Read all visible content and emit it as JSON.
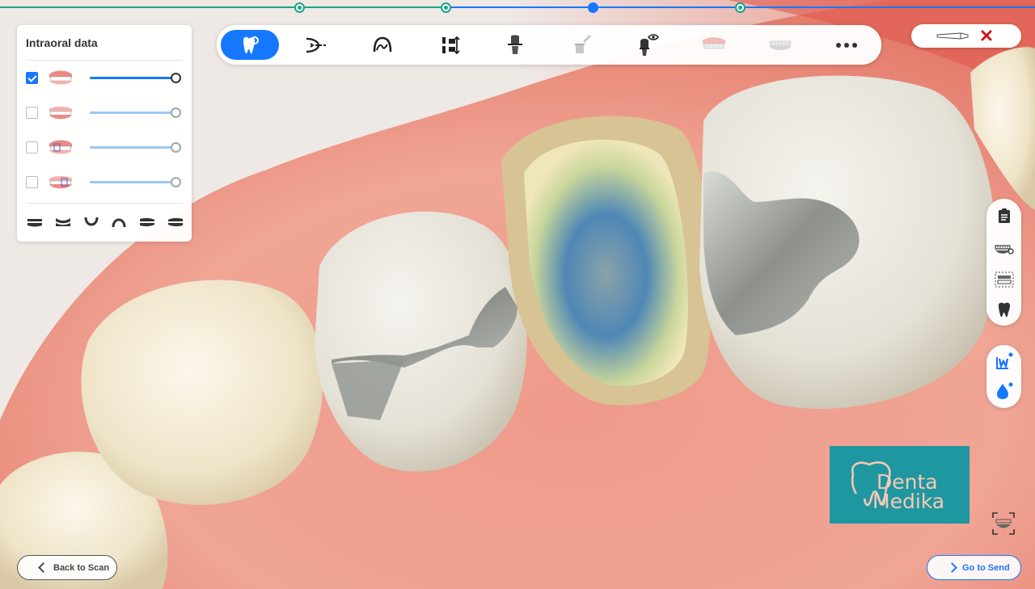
{
  "panel": {
    "title": "Intraoral data",
    "layers": [
      {
        "name": "Upper jaw scan",
        "checked": true,
        "opacity": 1.0
      },
      {
        "name": "Lower jaw scan",
        "checked": false,
        "opacity": 1.0
      },
      {
        "name": "Upper pre-op scan",
        "checked": false,
        "opacity": 1.0
      },
      {
        "name": "Lower pre-op scan",
        "checked": false,
        "opacity": 1.0
      }
    ],
    "view_icons": [
      "front-view-icon",
      "side-view-icon",
      "lower-occlusal-icon",
      "upper-occlusal-icon",
      "left-view-icon",
      "right-view-icon"
    ]
  },
  "toolbar": {
    "tools": [
      "tooth-select-icon",
      "trim-icon",
      "margin-line-icon",
      "insertion-axis-icon",
      "die-icon",
      "brush-icon",
      "visibility-icon",
      "upper-arch-icon",
      "lower-arch-icon",
      "more-icon"
    ],
    "active_index": 0
  },
  "steps": {
    "count": 4,
    "active_index": 2
  },
  "colors": {
    "accent": "#1677ff",
    "step_done": "#1aa38a",
    "close": "#d4141d",
    "logo_bg": "#1f97a0"
  },
  "logo": {
    "line1": "Denta",
    "line2": "Medika"
  },
  "footer": {
    "back_label": "Back to Scan",
    "send_label": "Go to Send"
  }
}
